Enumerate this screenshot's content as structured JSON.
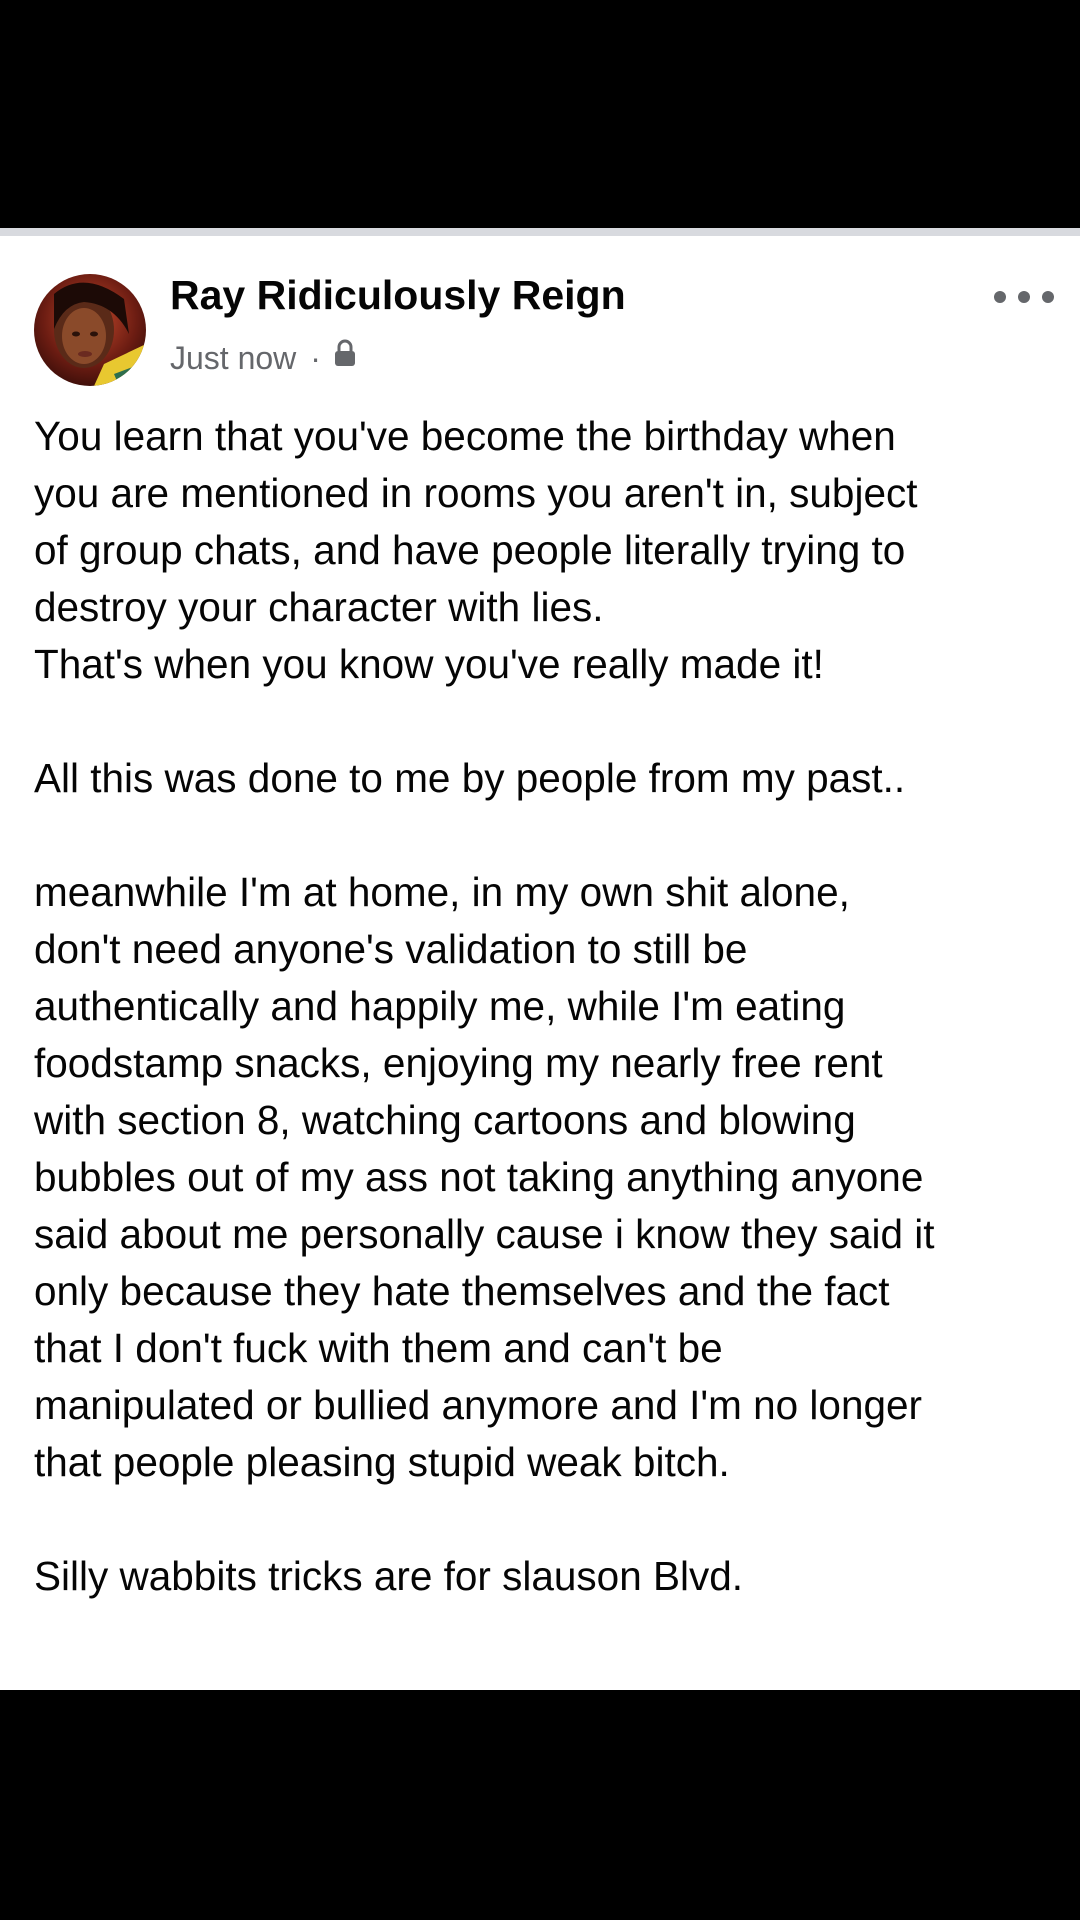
{
  "post": {
    "author": "Ray Ridiculously Reign",
    "timestamp": "Just now",
    "separator": "·",
    "privacy_icon": "lock-icon",
    "more_icon": "more-options-icon",
    "avatar_icon": "profile-photo"
  },
  "body": {
    "lines": [
      "You learn that you've become the birthday when",
      "you are mentioned in rooms you aren't in, subject",
      "of group chats, and have people literally trying to",
      "destroy your character with lies.",
      "That's when you know you've really made it!",
      "",
      "All this was done to me by people from my past..",
      "",
      "meanwhile I'm at home, in my own shit alone,",
      "don't need anyone's validation to still be",
      "authentically and happily me, while I'm eating",
      "foodstamp snacks, enjoying my nearly free rent",
      "with section 8, watching cartoons and blowing",
      "bubbles out of my ass not taking anything anyone",
      "said about me personally cause i know they said it",
      "only because they hate themselves and the fact",
      "that I don't fuck with them and can't be",
      "manipulated or bullied anymore and I'm no longer",
      "that people pleasing stupid weak bitch.",
      "",
      "Silly wabbits tricks are for slauson Blvd."
    ]
  },
  "colors": {
    "background": "#000000",
    "card": "#ffffff",
    "text": "#050505",
    "secondary_text": "#65676b",
    "divider": "#d8dadf"
  }
}
